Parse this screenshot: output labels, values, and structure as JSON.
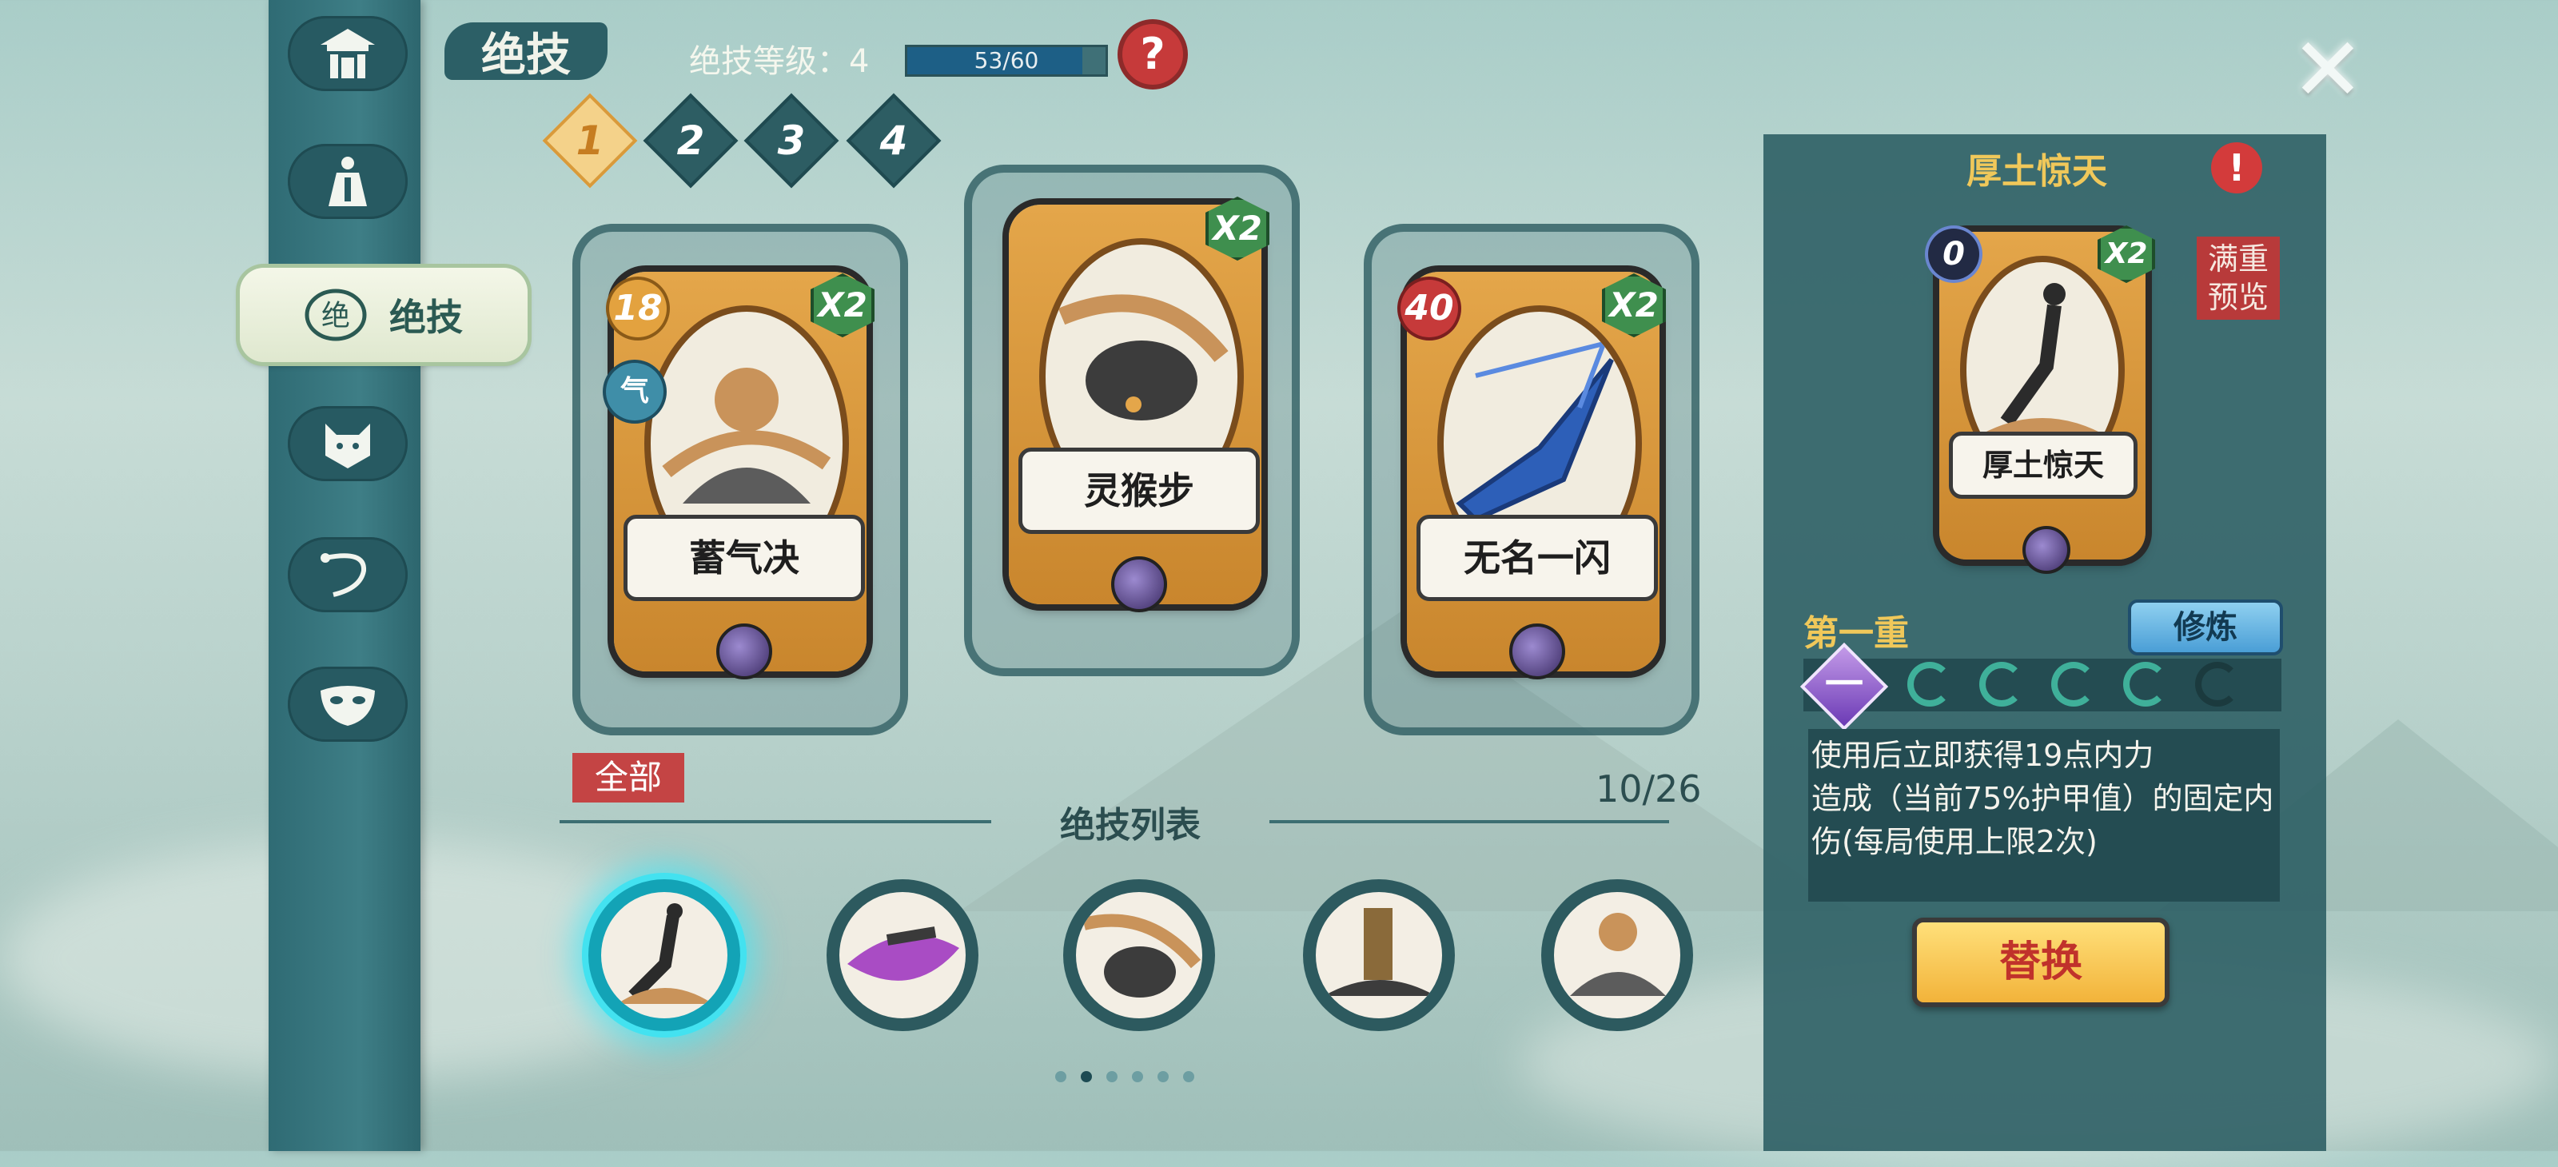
{
  "header": {
    "title": "绝技",
    "level_label": "绝技等级：4",
    "progress_text": "53/60",
    "progress": 0.883,
    "help_icon": "question-icon",
    "close_icon": "close-x-icon"
  },
  "sidebar": {
    "items": [
      {
        "icon": "pavilion-icon"
      },
      {
        "icon": "martial-figure-icon"
      },
      {
        "icon": "skill-emblem-icon",
        "label": "绝技",
        "active": true
      },
      {
        "icon": "cat-face-icon"
      },
      {
        "icon": "whip-icon"
      },
      {
        "icon": "mask-icon"
      }
    ]
  },
  "pages": [
    "1",
    "2",
    "3",
    "4"
  ],
  "selected_page": "1",
  "slots": [
    {
      "name": "蓄气决",
      "cost": "18",
      "multiplier": "X2",
      "extra_badge": "气"
    },
    {
      "name": "灵猴步",
      "multiplier": "X2"
    },
    {
      "name": "无名一闪",
      "cost": "40",
      "multiplier": "X2"
    }
  ],
  "list": {
    "filter": "全部",
    "title": "绝技列表",
    "count": "10/26",
    "pagination_total": 6,
    "pagination_active": 2
  },
  "detail": {
    "title": "厚土惊天",
    "alert_icon": "exclamation-icon",
    "card_name": "厚土惊天",
    "card_cost": "0",
    "card_multiplier": "X2",
    "full_preview": "满重预览",
    "tier_label": "第一重",
    "train_label": "修炼",
    "tier_gem": "一",
    "tiers_total": 5,
    "tiers_lit": 4,
    "description": "使用后立即获得19点内力\n造成（当前75%护甲值）的固定内伤(每局使用上限2次)",
    "replace_label": "替换"
  },
  "colors": {
    "accent_gold": "#f0c85a",
    "panel": "#2a5c62",
    "selected_glow": "#43e2f0",
    "danger": "#c63a3a"
  }
}
